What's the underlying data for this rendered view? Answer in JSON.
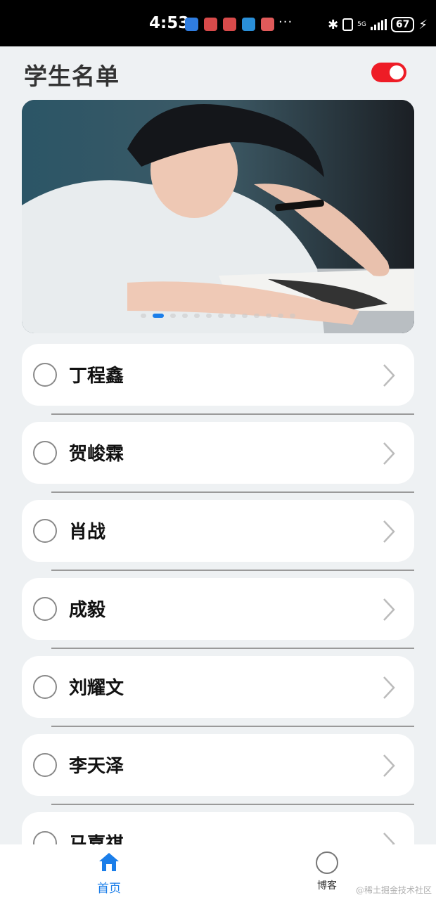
{
  "status_bar": {
    "time": "4:53",
    "notification_colors": [
      "#2f7de1",
      "#d84a4a",
      "#d84a4a",
      "#2a8fd8",
      "#e05a5a"
    ],
    "more": "···",
    "network": "5G",
    "battery": "67"
  },
  "header": {
    "title": "学生名单",
    "toggle_on": true,
    "toggle_color": "#ee1c26"
  },
  "banner": {
    "dots_total": 13,
    "active_dot": 1,
    "active_dot_color": "#1b7ee9"
  },
  "students": [
    {
      "name": "丁程鑫"
    },
    {
      "name": "贺峻霖"
    },
    {
      "name": "肖战"
    },
    {
      "name": "成毅"
    },
    {
      "name": "刘耀文"
    },
    {
      "name": "李天泽"
    },
    {
      "name": "马嘉祺"
    }
  ],
  "tabbar": {
    "home_label": "首页",
    "blog_label": "博客",
    "active_color": "#1b7ee9"
  },
  "watermark": "@稀土掘金技术社区"
}
